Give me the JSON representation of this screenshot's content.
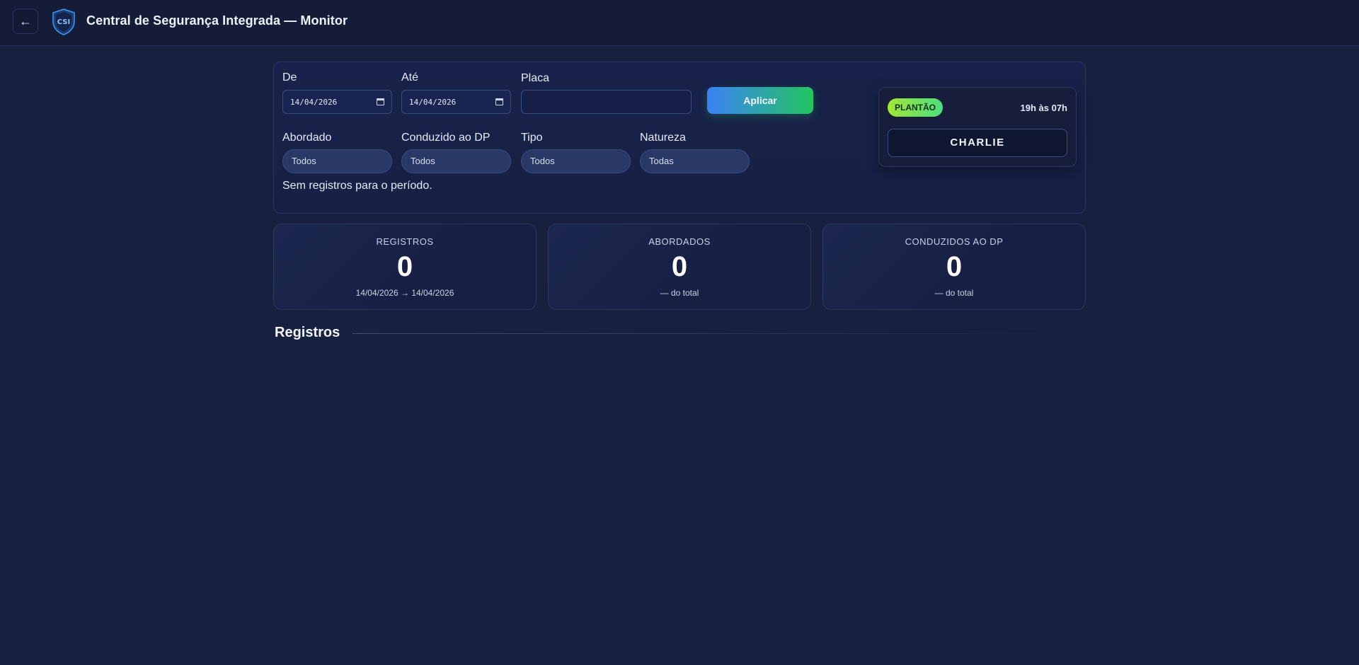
{
  "header": {
    "back_label": "←",
    "title": "Central de Segurança Integrada — Monitor",
    "logo_text": "CSI"
  },
  "filters": {
    "from": {
      "label": "De",
      "value": "14/04/2026"
    },
    "to": {
      "label": "Até",
      "value": "14/04/2026"
    },
    "plate": {
      "label": "Placa",
      "value": ""
    },
    "apply_label": "Aplicar",
    "abordado": {
      "label": "Abordado",
      "value": "Todos"
    },
    "conduzido": {
      "label": "Conduzido ao DP",
      "value": "Todos"
    },
    "tipo": {
      "label": "Tipo",
      "value": "Todos"
    },
    "natureza": {
      "label": "Natureza",
      "value": "Todas"
    },
    "empty_message": "Sem registros para o período."
  },
  "shift": {
    "badge": "PLANTÃO",
    "time": "19h às 07h",
    "team": "CHARLIE"
  },
  "stats": [
    {
      "label": "REGISTROS",
      "value": "0",
      "sub": "14/04/2026 → 14/04/2026"
    },
    {
      "label": "ABORDADOS",
      "value": "0",
      "sub": "— do total"
    },
    {
      "label": "CONDUZIDOS AO DP",
      "value": "0",
      "sub": "— do total"
    }
  ],
  "section": {
    "title": "Registros"
  },
  "colors": {
    "background": "#17203f",
    "accent_blue": "#3b82f6",
    "accent_green": "#22c55e"
  }
}
